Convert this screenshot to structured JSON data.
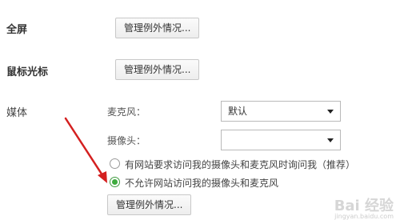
{
  "sections": {
    "fullscreen": {
      "label": "全屏",
      "button": "管理例外情况..."
    },
    "mouse_cursor": {
      "label": "鼠标光标",
      "button": "管理例外情况..."
    },
    "media": {
      "label": "媒体",
      "microphone_label": "麦克风：",
      "microphone_value": "默认",
      "camera_label": "摄像头：",
      "camera_value": "",
      "radio_ask": "有网站要求访问我的摄像头和麦克风时询问我（推荐）",
      "radio_block": "不允许网站访问我的摄像头和麦克风",
      "button": "管理例外情况..."
    }
  },
  "watermark": {
    "text": "Bai 经验",
    "url": "jingyan.baidu.com"
  },
  "colors": {
    "arrow": "#d42020",
    "radio_checked": "#3dab3d"
  }
}
